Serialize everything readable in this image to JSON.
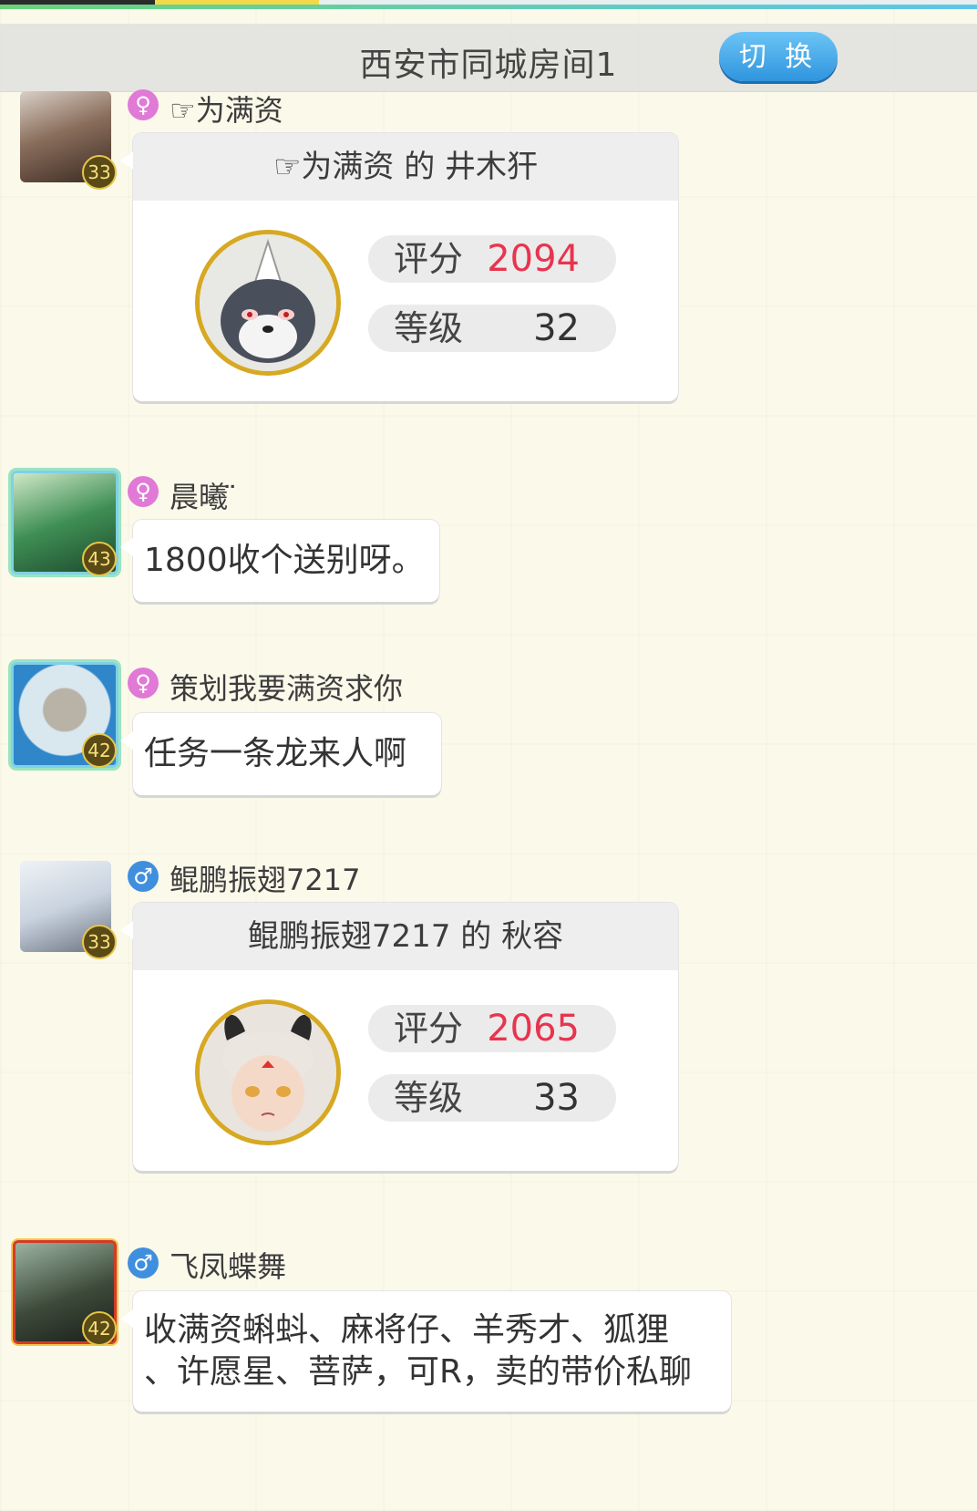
{
  "header": {
    "title": "西安市同城房间1",
    "switch_label": "切 换"
  },
  "messages": [
    {
      "gender": "♀",
      "gender_type": "female",
      "name": "☞为满资",
      "level": "33",
      "card": {
        "title": "☞为满资 的 井木犴",
        "score_label": "评分",
        "score": "2094",
        "grade_label": "等级",
        "grade": "32"
      }
    },
    {
      "gender": "♀",
      "gender_type": "female",
      "name": "晨曦 ̈",
      "level": "43",
      "text": "1800收个送别呀。"
    },
    {
      "gender": "♀",
      "gender_type": "female",
      "name": "策划我要满资求你",
      "level": "42",
      "text": "任务一条龙来人啊"
    },
    {
      "gender": "♂",
      "gender_type": "male",
      "name": "鲲鹏振翅7217",
      "level": "33",
      "card": {
        "title": "鲲鹏振翅7217 的 秋容",
        "score_label": "评分",
        "score": "2065",
        "grade_label": "等级",
        "grade": "33"
      }
    },
    {
      "gender": "♂",
      "gender_type": "male",
      "name": "飞凤蝶舞",
      "level": "42",
      "text_line1": "收满资蝌蚪、麻将仔、羊秀才、狐狸",
      "text_line2": "、许愿星、菩萨，可R，卖的带价私聊"
    }
  ]
}
